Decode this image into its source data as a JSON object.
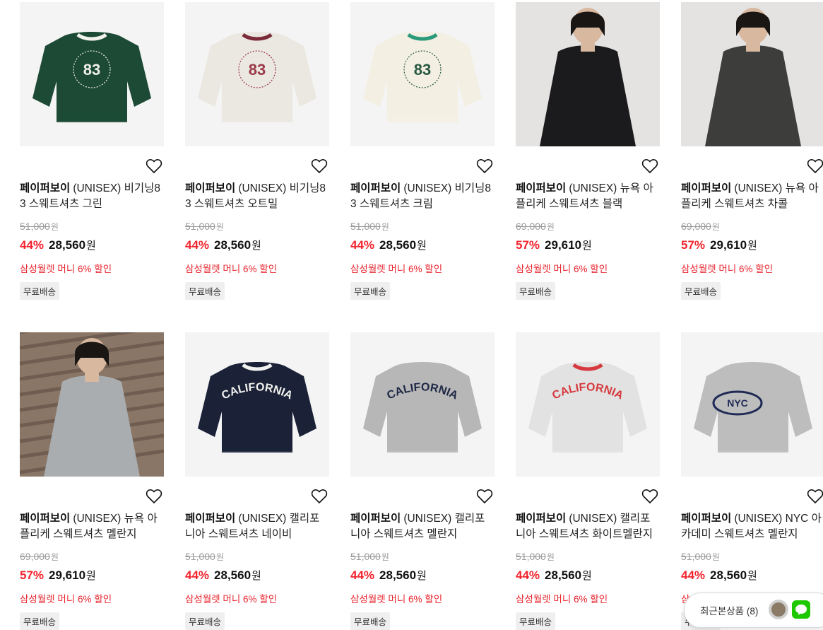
{
  "products": [
    {
      "brand": "페이퍼보이",
      "name": "(UNISEX) 비기닝83 스웨트셔츠 그린",
      "original_price": "51,000",
      "discount": "44%",
      "price": "28,560",
      "currency": "원",
      "promo": "삼성월렛 머니 6% 할인",
      "shipping": "무료배송",
      "image": "green-83-sweatshirt",
      "body_color": "#1c4a35",
      "neck_color": "#f2f2ee",
      "print_text": "83",
      "print_color": "#f0efe6",
      "print_style": "circle",
      "heart_icon": "heart-outline-icon"
    },
    {
      "brand": "페이퍼보이",
      "name": "(UNISEX) 비기닝83 스웨트셔츠 오트밀",
      "original_price": "51,000",
      "discount": "44%",
      "price": "28,560",
      "currency": "원",
      "promo": "삼성월렛 머니 6% 할인",
      "shipping": "무료배송",
      "image": "oatmeal-83-sweatshirt",
      "body_color": "#ebe7e1",
      "neck_color": "#7a2a38",
      "print_text": "83",
      "print_color": "#9b3a48",
      "print_style": "circle",
      "heart_icon": "heart-outline-icon"
    },
    {
      "brand": "페이퍼보이",
      "name": "(UNISEX) 비기닝83 스웨트셔츠 크림",
      "original_price": "51,000",
      "discount": "44%",
      "price": "28,560",
      "currency": "원",
      "promo": "삼성월렛 머니 6% 할인",
      "shipping": "무료배송",
      "image": "cream-83-sweatshirt",
      "body_color": "#f4efe3",
      "neck_color": "#2a9a7a",
      "print_text": "83",
      "print_color": "#2a5a44",
      "print_style": "circle",
      "heart_icon": "heart-outline-icon"
    },
    {
      "brand": "페이퍼보이",
      "name": "(UNISEX) 뉴욕 아플리케 스웨트셔츠 블랙",
      "original_price": "69,000",
      "discount": "57%",
      "price": "29,610",
      "currency": "원",
      "promo": "삼성월렛 머니 6% 할인",
      "shipping": "무료배송",
      "image": "model-black-sweatshirt",
      "body_color": "#1b1b1d",
      "neck_color": "#1b1b1d",
      "print_text": "",
      "print_color": "#2a2a2c",
      "print_style": "model",
      "heart_icon": "heart-outline-icon"
    },
    {
      "brand": "페이퍼보이",
      "name": "(UNISEX) 뉴욕 아플리케 스웨트셔츠 차콜",
      "original_price": "69,000",
      "discount": "57%",
      "price": "29,610",
      "currency": "원",
      "promo": "삼성월렛 머니 6% 할인",
      "shipping": "무료배송",
      "image": "model-charcoal-sweatshirt",
      "body_color": "#3d3d3b",
      "neck_color": "#3d3d3b",
      "print_text": "",
      "print_color": "#4a4a48",
      "print_style": "model",
      "heart_icon": "heart-outline-icon"
    },
    {
      "brand": "페이퍼보이",
      "name": "(UNISEX) 뉴욕 아플리케 스웨트셔츠 멜란지",
      "original_price": "69,000",
      "discount": "57%",
      "price": "29,610",
      "currency": "원",
      "promo": "삼성월렛 머니 6% 할인",
      "shipping": "무료배송",
      "image": "model-melange-sweatshirt",
      "body_color": "#a9adb0",
      "neck_color": "#a9adb0",
      "print_text": "",
      "print_color": "#9a9ea1",
      "print_style": "model-street",
      "heart_icon": "heart-outline-icon"
    },
    {
      "brand": "페이퍼보이",
      "name": "(UNISEX) 캘리포니아 스웨트셔츠 네이비",
      "original_price": "51,000",
      "discount": "44%",
      "price": "28,560",
      "currency": "원",
      "promo": "삼성월렛 머니 6% 할인",
      "shipping": "무료배송",
      "image": "navy-california-sweatshirt",
      "body_color": "#1b2238",
      "neck_color": "#f2f2ee",
      "print_text": "CALIFORNIA",
      "print_color": "#f2f2ee",
      "print_style": "arch",
      "heart_icon": "heart-outline-icon"
    },
    {
      "brand": "페이퍼보이",
      "name": "(UNISEX) 캘리포니아 스웨트셔츠 멜란지",
      "original_price": "51,000",
      "discount": "44%",
      "price": "28,560",
      "currency": "원",
      "promo": "삼성월렛 머니 6% 할인",
      "shipping": "무료배송",
      "image": "melange-california-sweatshirt",
      "body_color": "#b7b7b7",
      "neck_color": "#b7b7b7",
      "print_text": "CALIFORNIA",
      "print_color": "#1e2845",
      "print_style": "arch",
      "heart_icon": "heart-outline-icon"
    },
    {
      "brand": "페이퍼보이",
      "name": "(UNISEX) 캘리포니아 스웨트셔츠 화이트멜란지",
      "original_price": "51,000",
      "discount": "44%",
      "price": "28,560",
      "currency": "원",
      "promo": "삼성월렛 머니 6% 할인",
      "shipping": "무료배송",
      "image": "white-melange-california-sweatshirt",
      "body_color": "#e2e2e2",
      "neck_color": "#d63a3f",
      "print_text": "CALIFORNIA",
      "print_color": "#d63a3f",
      "print_style": "arch",
      "heart_icon": "heart-outline-icon"
    },
    {
      "brand": "페이퍼보이",
      "name": "(UNISEX) NYC 아카데미 스웨트셔츠 멜란지",
      "original_price": "51,000",
      "discount": "44%",
      "price": "28,560",
      "currency": "원",
      "promo": "삼성월렛 머니 6% 할인",
      "shipping": "무료배송",
      "image": "melange-nyc-sweatshirt",
      "body_color": "#bdbdbd",
      "neck_color": "#bdbdbd",
      "print_text": "NYC",
      "print_color": "#1e2a55",
      "print_style": "oval",
      "heart_icon": "heart-outline-icon"
    }
  ],
  "recent_viewed": {
    "label": "최근본상품 (8)",
    "chat_icon": "chat-icon"
  },
  "colors": {
    "discount": "#f2242e",
    "promo": "#e8262f",
    "original_price": "#999999"
  }
}
